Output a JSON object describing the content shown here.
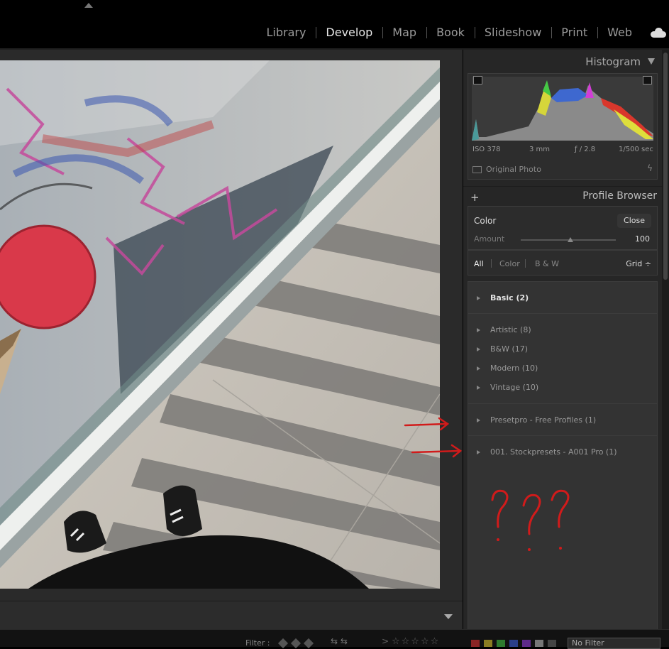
{
  "modules": [
    "Library",
    "Develop",
    "Map",
    "Book",
    "Slideshow",
    "Print",
    "Web"
  ],
  "active_module": "Develop",
  "histogram": {
    "title": "Histogram",
    "iso": "ISO 378",
    "focal": "3 mm",
    "aperture": "ƒ / 2.8",
    "shutter": "1/500 sec",
    "original_photo": "Original Photo"
  },
  "profile_browser": {
    "title": "Profile Browser",
    "profile_name": "Color",
    "close_label": "Close",
    "amount_label": "Amount",
    "amount_value": "100",
    "amount_level": 0.5,
    "filters": [
      "All",
      "Color",
      "B & W"
    ],
    "view_label": "Grid ÷",
    "groups": [
      {
        "items": [
          "Basic (2)"
        ]
      },
      {
        "items": [
          "Artistic (8)",
          "B&W (17)",
          "Modern (10)",
          "Vintage (10)"
        ]
      },
      {
        "items": [
          "Presetpro - Free Profiles (1)"
        ]
      },
      {
        "items": [
          "001. Stockpresets - A001 Pro (1)"
        ]
      }
    ]
  },
  "annotation": {
    "marks": "? ? ?",
    "color": "#d11b1b"
  },
  "filter_bar": {
    "filter_label": "Filter :",
    "stars": "☆☆☆☆☆",
    "gt": ">",
    "no_filter": "No Filter"
  },
  "colors": {
    "panel_bg": "#262626",
    "group_bg": "#333333",
    "annotation_red": "#d11b1b"
  }
}
